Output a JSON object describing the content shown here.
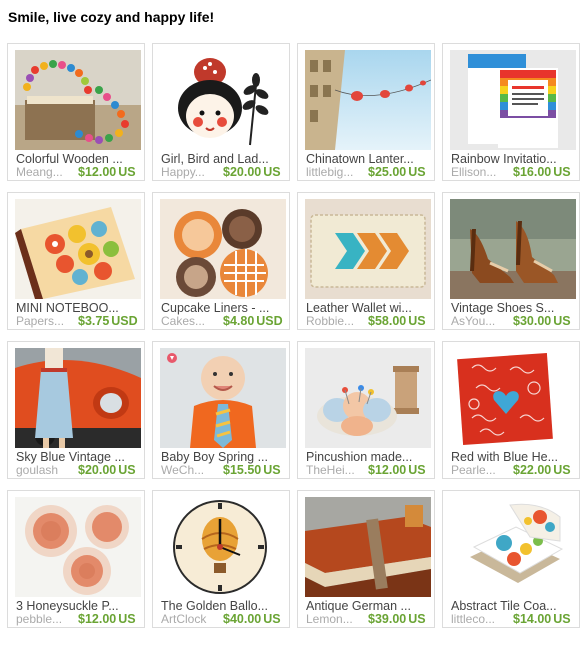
{
  "header": {
    "title": "Smile, live cozy and happy life!"
  },
  "colors": {
    "price": "#6aa434",
    "seller": "#aaaaaa",
    "card_border": "#dcdcdc"
  },
  "items": [
    {
      "name": "Colorful Wooden ...",
      "seller": "Meang...",
      "price": "$12.00",
      "currency": "US",
      "image": "wooden-bead-necklace-image"
    },
    {
      "name": "Girl, Bird and Lad...",
      "seller": "Happy...",
      "price": "$20.00",
      "currency": "US",
      "image": "girl-bird-illustration-image"
    },
    {
      "name": "Chinatown Lanter...",
      "seller": "littlebig...",
      "price": "$25.00",
      "currency": "US",
      "image": "chinatown-lanterns-image"
    },
    {
      "name": "Rainbow Invitatio...",
      "seller": "Ellison...",
      "price": "$16.00",
      "currency": "US",
      "image": "rainbow-invitation-image"
    },
    {
      "name": "MINI NOTEBOO...",
      "seller": "Papers...",
      "price": "$3.75",
      "currency": "USD",
      "image": "mini-notebook-image"
    },
    {
      "name": "Cupcake Liners - ...",
      "seller": "Cakes...",
      "price": "$4.80",
      "currency": "USD",
      "image": "cupcake-liners-image"
    },
    {
      "name": "Leather Wallet wi...",
      "seller": "Robbie...",
      "price": "$58.00",
      "currency": "US",
      "image": "leather-wallet-image"
    },
    {
      "name": "Vintage Shoes S...",
      "seller": "AsYou...",
      "price": "$30.00",
      "currency": "US",
      "image": "vintage-shoes-image"
    },
    {
      "name": "Sky Blue Vintage ...",
      "seller": "goulash",
      "price": "$20.00",
      "currency": "US",
      "image": "sky-blue-skirt-image"
    },
    {
      "name": "Baby Boy Spring ...",
      "seller": "WeCh...",
      "price": "$15.50",
      "currency": "US",
      "image": "baby-boy-tie-image"
    },
    {
      "name": "Pincushion made...",
      "seller": "TheHei...",
      "price": "$12.00",
      "currency": "US",
      "image": "pincushion-image"
    },
    {
      "name": "Red with Blue He...",
      "seller": "Pearle...",
      "price": "$22.00",
      "currency": "US",
      "image": "red-blue-heart-tile-image"
    },
    {
      "name": "3 Honeysuckle P...",
      "seller": "pebble...",
      "price": "$12.00",
      "currency": "US",
      "image": "honeysuckle-plates-image"
    },
    {
      "name": "The Golden Ballo...",
      "seller": "ArtClock",
      "price": "$40.00",
      "currency": "US",
      "image": "golden-balloon-clock-image"
    },
    {
      "name": "Antique German ...",
      "seller": "Lemon...",
      "price": "$39.00",
      "currency": "US",
      "image": "antique-german-books-image"
    },
    {
      "name": "Abstract Tile Coa...",
      "seller": "littleco...",
      "price": "$14.00",
      "currency": "US",
      "image": "abstract-tile-coasters-image"
    }
  ]
}
